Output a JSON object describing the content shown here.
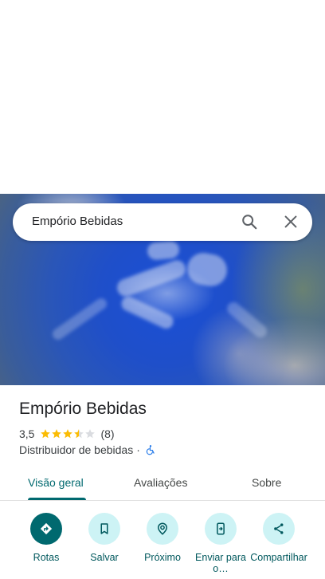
{
  "search": {
    "value": "Empório Bebidas"
  },
  "place": {
    "name": "Empório Bebidas",
    "rating": "3,5",
    "rating_value": 3.5,
    "review_count": "(8)",
    "category": "Distribuidor de bebidas",
    "separator": "·"
  },
  "tabs": [
    {
      "label": "Visão geral",
      "active": true
    },
    {
      "label": "Avaliações",
      "active": false
    },
    {
      "label": "Sobre",
      "active": false
    }
  ],
  "actions": [
    {
      "label": "Rotas",
      "icon": "directions-icon"
    },
    {
      "label": "Salvar",
      "icon": "bookmark-icon"
    },
    {
      "label": "Próximo",
      "icon": "nearby-icon"
    },
    {
      "label": "Enviar para o…",
      "icon": "send-to-phone-icon"
    },
    {
      "label": "Compartilhar",
      "icon": "share-icon"
    }
  ],
  "colors": {
    "accent": "#00696f",
    "star": "#fbbc04",
    "accessibility": "#1a73e8"
  }
}
